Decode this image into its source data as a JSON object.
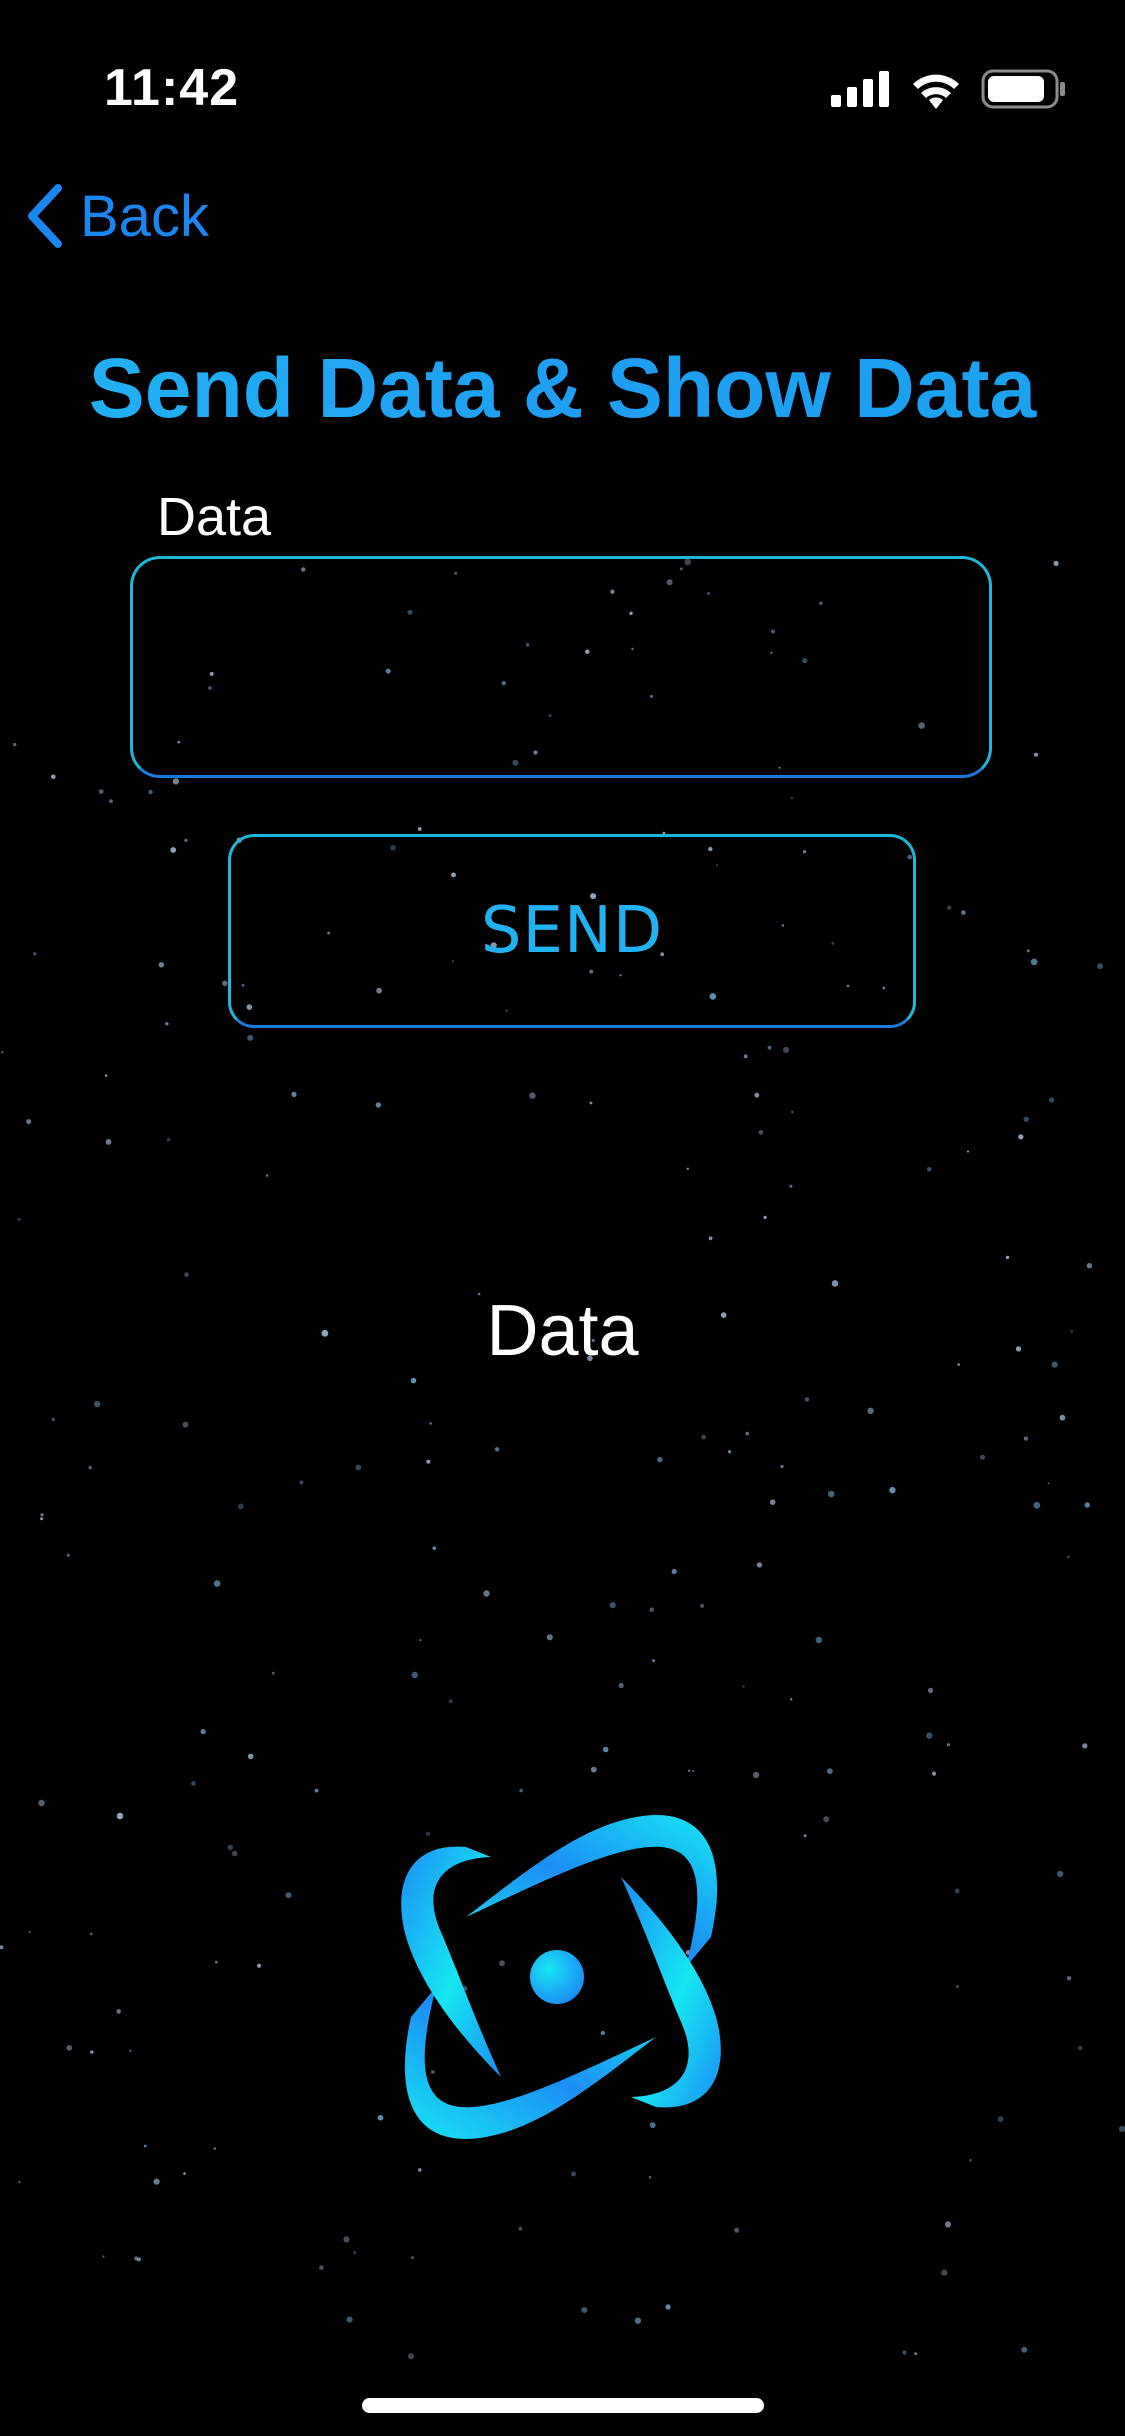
{
  "status_bar": {
    "time": "11:42",
    "icons": [
      "cellular-signal-icon",
      "wifi-icon",
      "battery-icon"
    ]
  },
  "nav": {
    "back_label": "Back",
    "back_icon": "chevron-left-icon"
  },
  "title": "Send Data & Show Data",
  "form": {
    "field_label": "Data",
    "input_value": "",
    "input_placeholder": "",
    "send_label": "SEND"
  },
  "output": {
    "text": "Data"
  },
  "logo": {
    "icon": "atom-orbit-logo-icon"
  },
  "colors": {
    "accent_blue": "#1a86f0",
    "title_blue": "#1f9ef3",
    "border_cyan": "#1fb7d8",
    "logo_cyan": "#16e6f2",
    "logo_blue": "#1c8ef5",
    "background": "#000000"
  }
}
